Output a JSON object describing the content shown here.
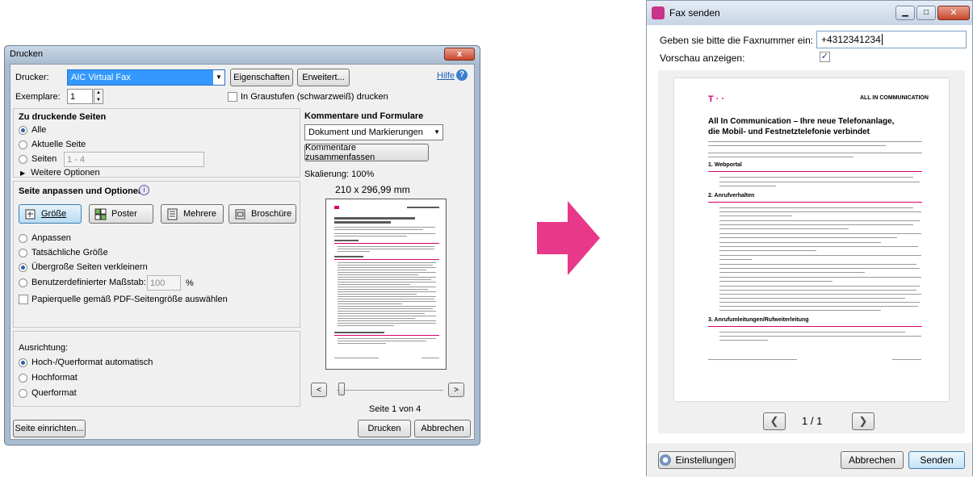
{
  "print_dialog": {
    "title": "Drucken",
    "close_label": "x",
    "printer_label": "Drucker:",
    "printer_value": "AIC Virtual Fax",
    "properties_button": "Eigenschaften",
    "advanced_button": "Erweitert...",
    "help_link": "Hilfe",
    "copies_label": "Exemplare:",
    "copies_value": "1",
    "grayscale_label": "In Graustufen (schwarzweiß) drucken",
    "pages_section": {
      "title": "Zu druckende Seiten",
      "all": "Alle",
      "current": "Aktuelle Seite",
      "pages": "Seiten",
      "pages_value": "1 - 4",
      "more": "Weitere Optionen"
    },
    "fit_section": {
      "title": "Seite anpassen und Optionen",
      "buttons": [
        "Größe",
        "Poster",
        "Mehrere",
        "Broschüre"
      ],
      "fit": "Anpassen",
      "actual": "Tatsächliche Größe",
      "shrink": "Übergroße Seiten verkleinern",
      "custom": "Benutzerdefinierter Maßstab:",
      "custom_value": "100",
      "percent": "%",
      "paper_source": "Papierquelle gemäß PDF-Seitengröße auswählen"
    },
    "orientation": {
      "title": "Ausrichtung:",
      "auto": "Hoch-/Querformat automatisch",
      "portrait": "Hochformat",
      "landscape": "Querformat"
    },
    "comments": {
      "title": "Kommentare und Formulare",
      "select_value": "Dokument und Markierungen",
      "summarize_button": "Kommentare zusammenfassen",
      "scale": "Skalierung: 100%",
      "dimensions": "210 x 296,99 mm",
      "page_indicator": "Seite 1 von 4"
    },
    "page_setup_button": "Seite einrichten...",
    "print_button": "Drucken",
    "cancel_button": "Abbrechen"
  },
  "fax_dialog": {
    "title": "Fax senden",
    "fax_label": "Geben sie bitte die Faxnummer ein:",
    "fax_value": "+4312341234",
    "preview_label": "Vorschau anzeigen:",
    "preview_checked": true,
    "page_counter": "1 / 1",
    "settings_button": "Einstellungen",
    "cancel_button": "Abbrechen",
    "send_button": "Senden"
  },
  "document_preview": {
    "brand": "ALL IN COMMUNICATION",
    "heading_line1": "All In Communication – Ihre neue Telefonanlage,",
    "heading_line2": "die Mobil- und Festnetztelefonie verbindet",
    "section1": "1.     Webportal",
    "section2": "2.     Anrufverhalten",
    "section3": "3.     Anrufumleitungen/Rufweiterleitung"
  },
  "colors": {
    "arrow": "#e8388a",
    "accent_magenta": "#d5006d",
    "selection_blue": "#3399ff"
  },
  "icons": [
    "help-icon",
    "spinner-up-icon",
    "spinner-down-icon",
    "chevron-left-icon",
    "chevron-right-icon",
    "fax-app-icon",
    "settings-icon"
  ]
}
